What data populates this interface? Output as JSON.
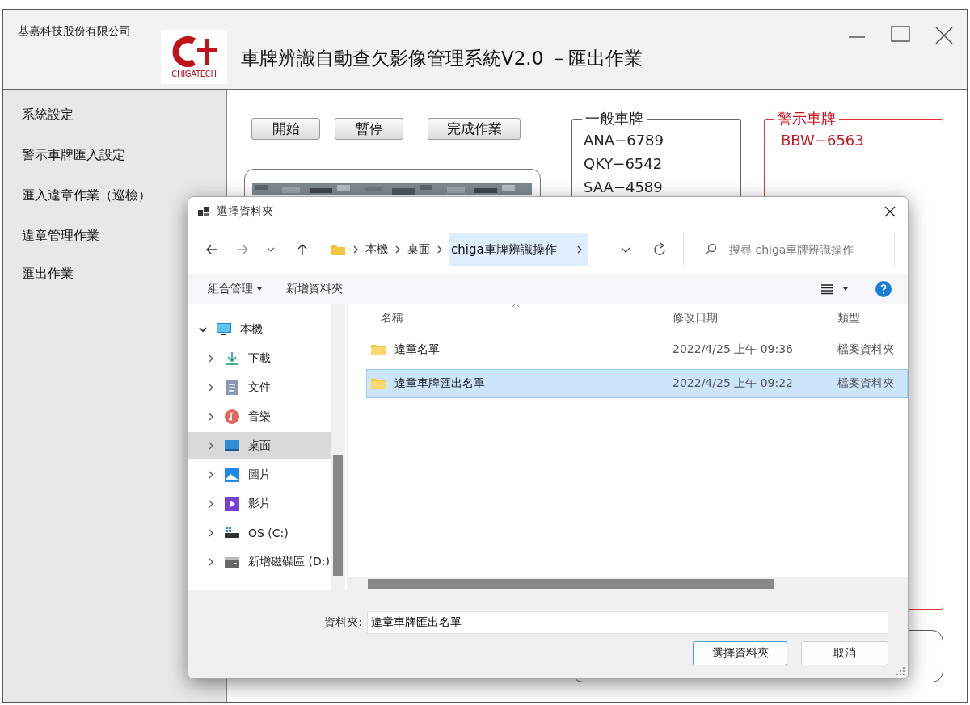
{
  "window": {
    "company": "基嘉科技股份有限公司",
    "logo_text": "CHIGATECH",
    "title": "車牌辨識自動查欠影像管理系統V2.0 －匯出作業"
  },
  "sidebar": {
    "items": [
      "系統設定",
      "警示車牌匯入設定",
      "匯入違章作業（巡檢）",
      "違章管理作業",
      "匯出作業"
    ]
  },
  "actions": [
    "開始",
    "暫停",
    "完成作業"
  ],
  "normal_plates": {
    "title": "一般車牌",
    "items": [
      "ANA−6789",
      "QKY−6542",
      "SAA−4589"
    ]
  },
  "warning_plates": {
    "title": "警示車牌",
    "items": [
      "BBW−6563"
    ]
  },
  "dialog": {
    "title": "選擇資料夾",
    "breadcrumb": [
      "本機",
      "桌面",
      "chiga車牌辨識操作"
    ],
    "search": {
      "placeholder": "搜尋 chiga車牌辨識操作"
    },
    "commands": [
      {
        "label": "組合管理",
        "kind": "menu"
      },
      {
        "label": "新增資料夾",
        "kind": "plain"
      }
    ],
    "tree": [
      {
        "label": "本機",
        "kind": "pc",
        "expanded": true,
        "selected": false,
        "children": [
          {
            "label": "下載",
            "kind": "download",
            "expanded": false,
            "selected": false
          },
          {
            "label": "文件",
            "kind": "documents",
            "expanded": false,
            "selected": false
          },
          {
            "label": "音樂",
            "kind": "music",
            "expanded": false,
            "selected": false
          },
          {
            "label": "桌面",
            "kind": "desktop",
            "expanded": false,
            "selected": true
          },
          {
            "label": "圖片",
            "kind": "pictures",
            "expanded": false,
            "selected": false
          },
          {
            "label": "影片",
            "kind": "videos",
            "expanded": false,
            "selected": false
          },
          {
            "label": "OS (C:)",
            "kind": "system-drive",
            "expanded": false,
            "selected": false
          },
          {
            "label": "新增磁碟區 (D:)",
            "kind": "drive",
            "expanded": false,
            "selected": false
          }
        ]
      }
    ],
    "columns": [
      "名稱",
      "修改日期",
      "類型"
    ],
    "rows": [
      {
        "name": "違章名單",
        "modified": "2022/4/25 上午 09:36",
        "type": "檔案資料夾",
        "selected": false
      },
      {
        "name": "違章車牌匯出名單",
        "modified": "2022/4/25 上午 09:22",
        "type": "檔案資料夾",
        "selected": true
      }
    ],
    "folder_label": "資料夾:",
    "folder_value": "違章車牌匯出名單",
    "buttons": [
      {
        "label": "選擇資料夾",
        "kind": "primary"
      },
      {
        "label": "取消",
        "kind": "secondary"
      }
    ]
  }
}
